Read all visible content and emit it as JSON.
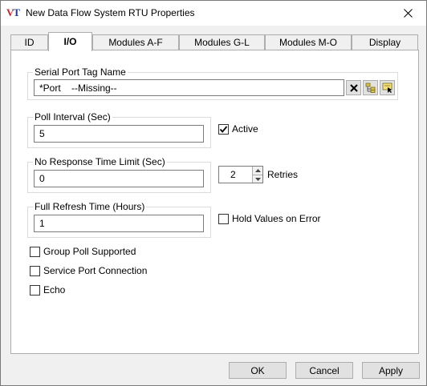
{
  "window": {
    "title": "New Data Flow System RTU Properties",
    "app_icon_text_v": "V",
    "app_icon_text_t": "T"
  },
  "tabs": [
    {
      "label": "ID",
      "active": false
    },
    {
      "label": "I/O",
      "active": true
    },
    {
      "label": "Modules A-F",
      "active": false
    },
    {
      "label": "Modules G-L",
      "active": false
    },
    {
      "label": "Modules M-O",
      "active": false
    },
    {
      "label": "Display",
      "active": false
    }
  ],
  "serial_port": {
    "label": "Serial Port Tag Name",
    "value": "*Port    --Missing--",
    "buttons": [
      "clear-icon",
      "tag-browser-icon",
      "tag-select-icon"
    ]
  },
  "poll_interval": {
    "label": "Poll Interval (Sec)",
    "value": "5"
  },
  "active": {
    "label": "Active",
    "checked": true
  },
  "no_response": {
    "label": "No Response Time Limit (Sec)",
    "value": "0"
  },
  "retries": {
    "label": "Retries",
    "value": "2"
  },
  "full_refresh": {
    "label": "Full Refresh Time (Hours)",
    "value": "1"
  },
  "hold_values": {
    "label": "Hold Values on Error",
    "checked": false
  },
  "options": [
    {
      "label": "Group Poll Supported",
      "checked": false
    },
    {
      "label": "Service Port Connection",
      "checked": false
    },
    {
      "label": "Echo",
      "checked": false
    }
  ],
  "buttons": {
    "ok": "OK",
    "cancel": "Cancel",
    "apply": "Apply"
  },
  "colors": {
    "logo_v": "#c1272d",
    "logo_t": "#1f3a93",
    "panel_bg": "#ffffff",
    "window_bg": "#f0f0f0"
  }
}
